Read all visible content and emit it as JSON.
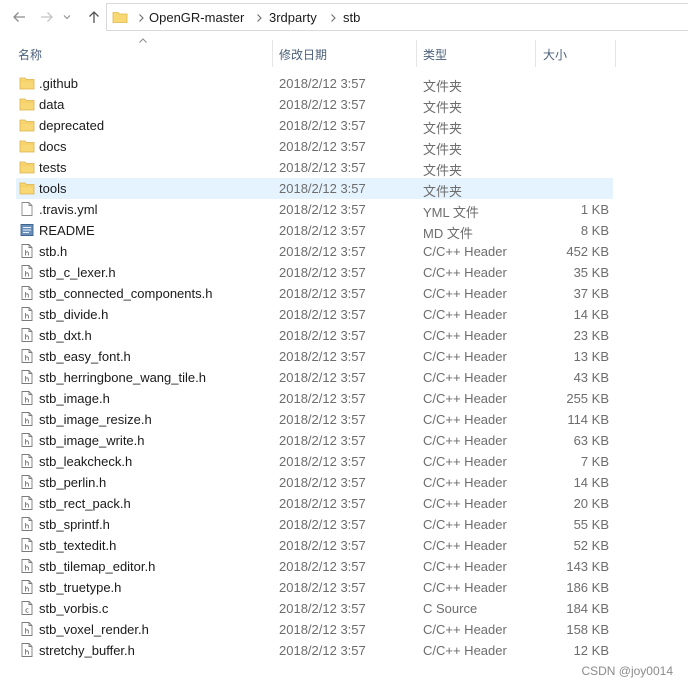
{
  "breadcrumb": [
    "OpenGR-master",
    "3rdparty",
    "stb"
  ],
  "columns": {
    "name": "名称",
    "date": "修改日期",
    "type": "类型",
    "size": "大小"
  },
  "files": [
    {
      "name": ".github",
      "date": "2018/2/12 3:57",
      "type": "文件夹",
      "size": "",
      "icon": "folder-icon",
      "selected": false
    },
    {
      "name": "data",
      "date": "2018/2/12 3:57",
      "type": "文件夹",
      "size": "",
      "icon": "folder-icon",
      "selected": false
    },
    {
      "name": "deprecated",
      "date": "2018/2/12 3:57",
      "type": "文件夹",
      "size": "",
      "icon": "folder-icon",
      "selected": false
    },
    {
      "name": "docs",
      "date": "2018/2/12 3:57",
      "type": "文件夹",
      "size": "",
      "icon": "folder-icon",
      "selected": false
    },
    {
      "name": "tests",
      "date": "2018/2/12 3:57",
      "type": "文件夹",
      "size": "",
      "icon": "folder-icon",
      "selected": false
    },
    {
      "name": "tools",
      "date": "2018/2/12 3:57",
      "type": "文件夹",
      "size": "",
      "icon": "folder-icon",
      "selected": true
    },
    {
      "name": ".travis.yml",
      "date": "2018/2/12 3:57",
      "type": "YML 文件",
      "size": "1 KB",
      "icon": "blank-file-icon",
      "selected": false
    },
    {
      "name": "README",
      "date": "2018/2/12 3:57",
      "type": "MD 文件",
      "size": "8 KB",
      "icon": "markdown-file-icon",
      "selected": false
    },
    {
      "name": "stb.h",
      "date": "2018/2/12 3:57",
      "type": "C/C++ Header",
      "size": "452 KB",
      "icon": "header-file-icon",
      "selected": false
    },
    {
      "name": "stb_c_lexer.h",
      "date": "2018/2/12 3:57",
      "type": "C/C++ Header",
      "size": "35 KB",
      "icon": "header-file-icon",
      "selected": false
    },
    {
      "name": "stb_connected_components.h",
      "date": "2018/2/12 3:57",
      "type": "C/C++ Header",
      "size": "37 KB",
      "icon": "header-file-icon",
      "selected": false
    },
    {
      "name": "stb_divide.h",
      "date": "2018/2/12 3:57",
      "type": "C/C++ Header",
      "size": "14 KB",
      "icon": "header-file-icon",
      "selected": false
    },
    {
      "name": "stb_dxt.h",
      "date": "2018/2/12 3:57",
      "type": "C/C++ Header",
      "size": "23 KB",
      "icon": "header-file-icon",
      "selected": false
    },
    {
      "name": "stb_easy_font.h",
      "date": "2018/2/12 3:57",
      "type": "C/C++ Header",
      "size": "13 KB",
      "icon": "header-file-icon",
      "selected": false
    },
    {
      "name": "stb_herringbone_wang_tile.h",
      "date": "2018/2/12 3:57",
      "type": "C/C++ Header",
      "size": "43 KB",
      "icon": "header-file-icon",
      "selected": false
    },
    {
      "name": "stb_image.h",
      "date": "2018/2/12 3:57",
      "type": "C/C++ Header",
      "size": "255 KB",
      "icon": "header-file-icon",
      "selected": false
    },
    {
      "name": "stb_image_resize.h",
      "date": "2018/2/12 3:57",
      "type": "C/C++ Header",
      "size": "114 KB",
      "icon": "header-file-icon",
      "selected": false
    },
    {
      "name": "stb_image_write.h",
      "date": "2018/2/12 3:57",
      "type": "C/C++ Header",
      "size": "63 KB",
      "icon": "header-file-icon",
      "selected": false
    },
    {
      "name": "stb_leakcheck.h",
      "date": "2018/2/12 3:57",
      "type": "C/C++ Header",
      "size": "7 KB",
      "icon": "header-file-icon",
      "selected": false
    },
    {
      "name": "stb_perlin.h",
      "date": "2018/2/12 3:57",
      "type": "C/C++ Header",
      "size": "14 KB",
      "icon": "header-file-icon",
      "selected": false
    },
    {
      "name": "stb_rect_pack.h",
      "date": "2018/2/12 3:57",
      "type": "C/C++ Header",
      "size": "20 KB",
      "icon": "header-file-icon",
      "selected": false
    },
    {
      "name": "stb_sprintf.h",
      "date": "2018/2/12 3:57",
      "type": "C/C++ Header",
      "size": "55 KB",
      "icon": "header-file-icon",
      "selected": false
    },
    {
      "name": "stb_textedit.h",
      "date": "2018/2/12 3:57",
      "type": "C/C++ Header",
      "size": "52 KB",
      "icon": "header-file-icon",
      "selected": false
    },
    {
      "name": "stb_tilemap_editor.h",
      "date": "2018/2/12 3:57",
      "type": "C/C++ Header",
      "size": "143 KB",
      "icon": "header-file-icon",
      "selected": false
    },
    {
      "name": "stb_truetype.h",
      "date": "2018/2/12 3:57",
      "type": "C/C++ Header",
      "size": "186 KB",
      "icon": "header-file-icon",
      "selected": false
    },
    {
      "name": "stb_vorbis.c",
      "date": "2018/2/12 3:57",
      "type": "C Source",
      "size": "184 KB",
      "icon": "source-file-icon",
      "selected": false
    },
    {
      "name": "stb_voxel_render.h",
      "date": "2018/2/12 3:57",
      "type": "C/C++ Header",
      "size": "158 KB",
      "icon": "header-file-icon",
      "selected": false
    },
    {
      "name": "stretchy_buffer.h",
      "date": "2018/2/12 3:57",
      "type": "C/C++ Header",
      "size": "12 KB",
      "icon": "header-file-icon",
      "selected": false
    }
  ],
  "watermark": "CSDN @joy0014",
  "colors": {
    "selection": "#e5f3ff",
    "folder": "#f8d775",
    "header_text": "#4c607a",
    "secondary_text": "#6d6d6d"
  }
}
